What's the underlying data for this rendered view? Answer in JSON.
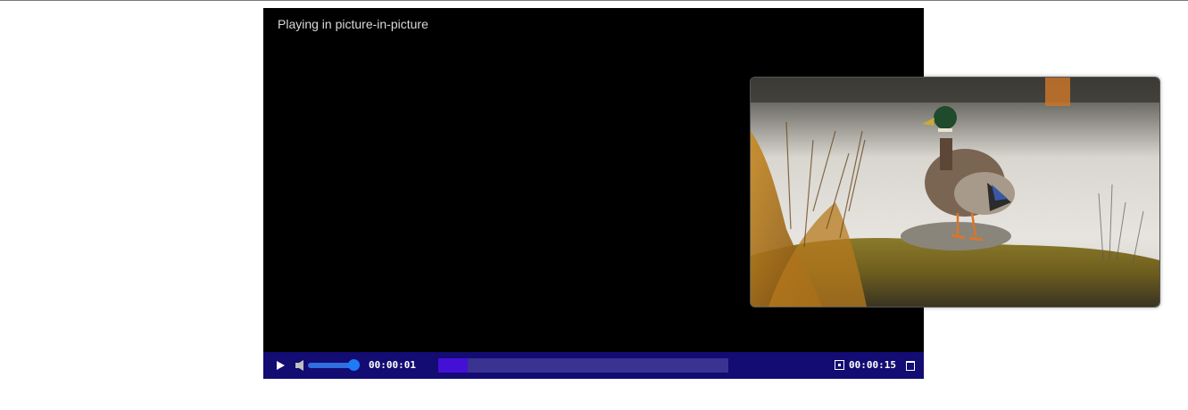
{
  "player": {
    "status_text": "Playing in picture-in-picture",
    "current_time": "00:00:01",
    "total_time": "00:00:15",
    "volume_level": 1.0,
    "progress_fraction": 0.1,
    "icons": {
      "play": "play-icon",
      "mute": "speaker-icon",
      "pip": "picture-in-picture-icon",
      "fullscreen": "fullscreen-icon"
    },
    "colors": {
      "control_bar": "#130c73",
      "progress_track": "#3a3391",
      "progress_fill": "#4510d6",
      "volume": "#1e7bf5"
    }
  },
  "pip_window": {
    "content": "video-frame"
  }
}
